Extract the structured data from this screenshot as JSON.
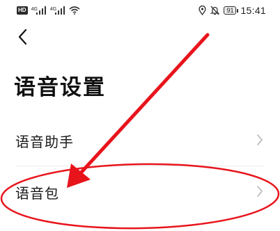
{
  "status_bar": {
    "hd_label": "HD",
    "signal_label_1": "4G",
    "signal_label_2": "4G",
    "battery_level": "91",
    "time": "15:41",
    "icons": [
      "hd-icon",
      "signal-icon",
      "signal-icon",
      "wifi-icon",
      "location-icon",
      "mute-icon",
      "battery-icon"
    ]
  },
  "header": {
    "back_icon": "chevron-left-icon"
  },
  "page": {
    "title": "语音设置"
  },
  "list": [
    {
      "label": "语音助手",
      "icon": "chevron-right-icon"
    },
    {
      "label": "语音包",
      "icon": "chevron-right-icon"
    }
  ],
  "annotation": {
    "color": "#e8141b",
    "shapes": [
      "arrow",
      "ellipse"
    ]
  },
  "colors": {
    "background": "#ffffff",
    "text": "#111111",
    "chevron": "#b5b5b5",
    "divider": "#ececec"
  }
}
